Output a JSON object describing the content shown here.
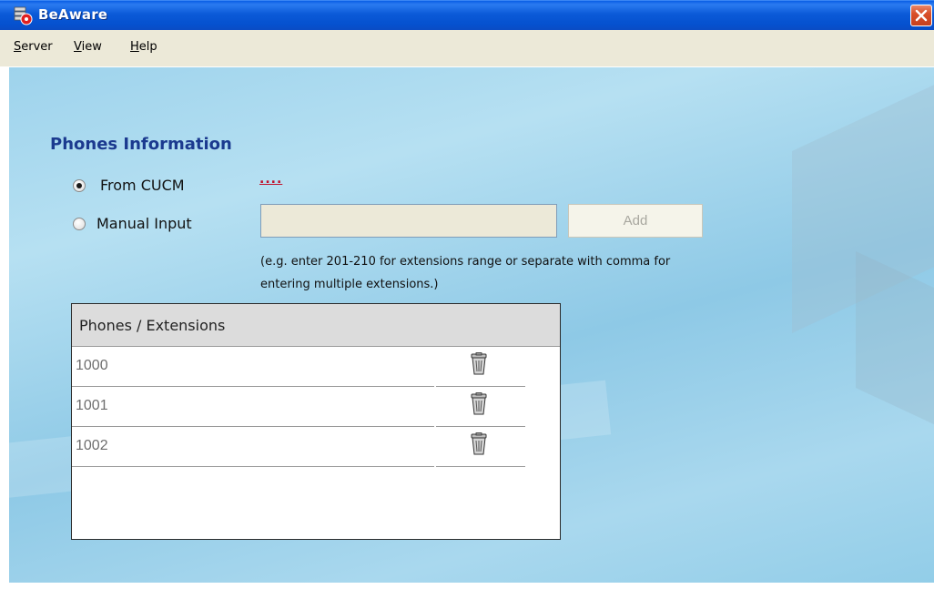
{
  "window": {
    "title": "BeAware",
    "icon": "app-icon",
    "close_icon": "close-icon"
  },
  "menu": {
    "items": [
      {
        "label_accel": "S",
        "label_rest": "erver"
      },
      {
        "label_accel": "V",
        "label_rest": "iew"
      },
      {
        "label_accel": "H",
        "label_rest": "elp"
      }
    ]
  },
  "phones": {
    "section_title": "Phones Information",
    "radio_from_cucm": "From CUCM",
    "radio_from_cucm_selected": true,
    "cucm_link": "....",
    "radio_manual": "Manual Input",
    "radio_manual_selected": false,
    "manual_input_value": "",
    "add_button": "Add",
    "hint_line1": "(e.g. enter 201-210 for extensions range or separate with comma for",
    "hint_line2": "entering multiple extensions.)",
    "table_header": "Phones / Extensions",
    "rows": [
      {
        "ext": "1000",
        "delete_icon": "trash-icon"
      },
      {
        "ext": "1001",
        "delete_icon": "trash-icon"
      },
      {
        "ext": "1002",
        "delete_icon": "trash-icon"
      }
    ]
  },
  "colors": {
    "title_bar": "#0b5ad8",
    "section_title": "#1b3a8f",
    "link": "#c0102a",
    "panel_background": "#9ed3ec"
  }
}
